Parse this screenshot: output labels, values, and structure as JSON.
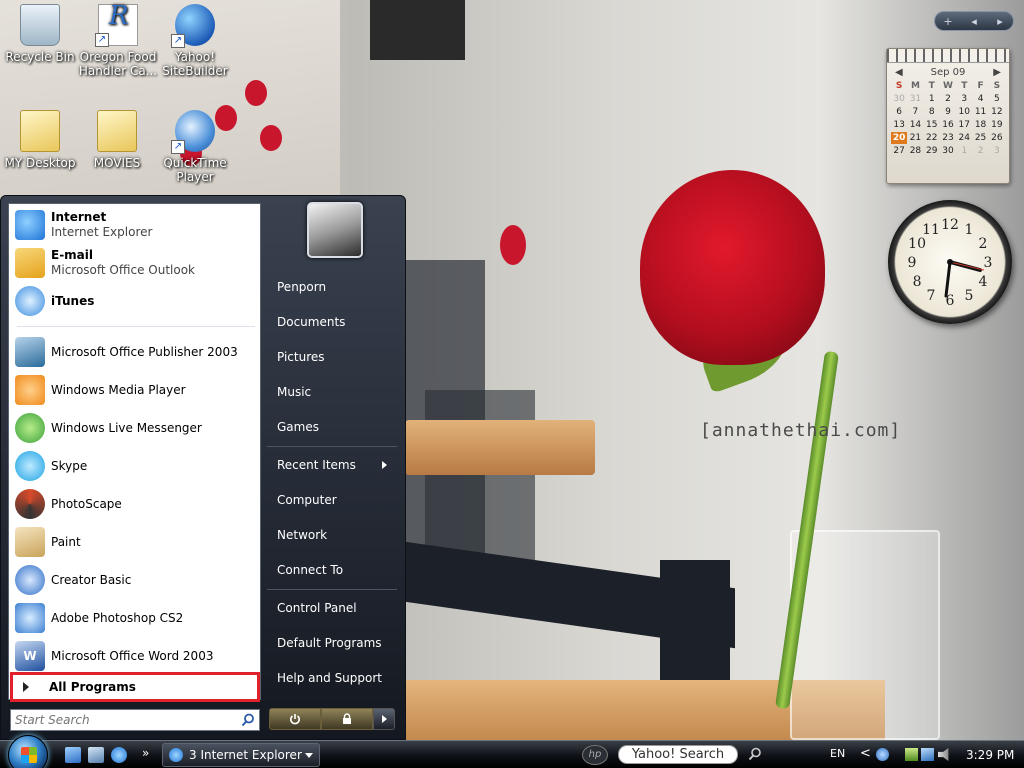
{
  "desktop": {
    "icons": [
      {
        "label": "Recycle Bin",
        "icon": "recycle-bin-icon"
      },
      {
        "label": "Oregon Food Handler Ca...",
        "icon": "document-shortcut-icon"
      },
      {
        "label": "Yahoo! SiteBuilder",
        "icon": "globe-icon"
      },
      {
        "label": "MY Desktop",
        "icon": "folder-icon"
      },
      {
        "label": "MOVIES",
        "icon": "folder-icon"
      },
      {
        "label": "QuickTime Player",
        "icon": "quicktime-icon"
      }
    ],
    "watermark": "[annathethai.com]"
  },
  "gadgets": {
    "toolbar": {
      "add": "+",
      "prev": "◂",
      "next": "▸"
    },
    "calendar": {
      "month": "Sep 09",
      "prev": "◀",
      "next": "▶",
      "weekday_headers": [
        "S",
        "M",
        "T",
        "W",
        "T",
        "F",
        "S"
      ],
      "days": [
        "30",
        "31",
        "1",
        "2",
        "3",
        "4",
        "5",
        "6",
        "7",
        "8",
        "9",
        "10",
        "11",
        "12",
        "13",
        "14",
        "15",
        "16",
        "17",
        "18",
        "19",
        "20",
        "21",
        "22",
        "23",
        "24",
        "25",
        "26",
        "27",
        "28",
        "29",
        "30",
        "1",
        "2",
        "3"
      ],
      "today": "20"
    },
    "clock": {
      "numbers": [
        "12",
        "1",
        "2",
        "3",
        "4",
        "5",
        "6",
        "7",
        "8",
        "9",
        "10",
        "11"
      ]
    }
  },
  "start_menu": {
    "pinned": [
      {
        "name": "Internet",
        "sub": "Internet Explorer",
        "icon": "internet-explorer-icon",
        "color": "#1e73d8"
      },
      {
        "name": "E-mail",
        "sub": "Microsoft Office Outlook",
        "icon": "outlook-icon",
        "color": "#e5a21c"
      },
      {
        "name": "iTunes",
        "sub": "",
        "icon": "itunes-icon",
        "color": "#3a8de0"
      }
    ],
    "recent": [
      {
        "name": "Microsoft Office Publisher 2003",
        "icon": "publisher-icon",
        "color": "#2a6b9a"
      },
      {
        "name": "Windows Media Player",
        "icon": "media-player-icon",
        "color": "#f08a1c"
      },
      {
        "name": "Windows Live Messenger",
        "icon": "messenger-icon",
        "color": "#3ca23c"
      },
      {
        "name": "Skype",
        "icon": "skype-icon",
        "color": "#1ba3e4"
      },
      {
        "name": "PhotoScape",
        "icon": "photoscape-icon",
        "color": "#d74a2a"
      },
      {
        "name": "Paint",
        "icon": "paint-icon",
        "color": "#c9a35a"
      },
      {
        "name": "Creator Basic",
        "icon": "creator-basic-icon",
        "color": "#2f6fc6"
      },
      {
        "name": "Adobe Photoshop CS2",
        "icon": "photoshop-icon",
        "color": "#3b7fd1"
      },
      {
        "name": "Microsoft Office Word 2003",
        "icon": "word-icon",
        "color": "#1f4f9e"
      }
    ],
    "all_programs": "All Programs",
    "search_placeholder": "Start Search",
    "right": {
      "user": "Penporn",
      "items1": [
        "Documents",
        "Pictures",
        "Music",
        "Games"
      ],
      "recent_items": "Recent Items",
      "items2": [
        "Computer",
        "Network",
        "Connect To"
      ],
      "items3": [
        "Control Panel",
        "Default Programs",
        "Help and Support"
      ]
    }
  },
  "taskbar": {
    "task_label": "3 Internet Explorer",
    "quick_launch_more": "»",
    "yahoo_search": "Yahoo! Search",
    "language": "EN",
    "tray_expand": "<",
    "time": "3:29 PM"
  }
}
